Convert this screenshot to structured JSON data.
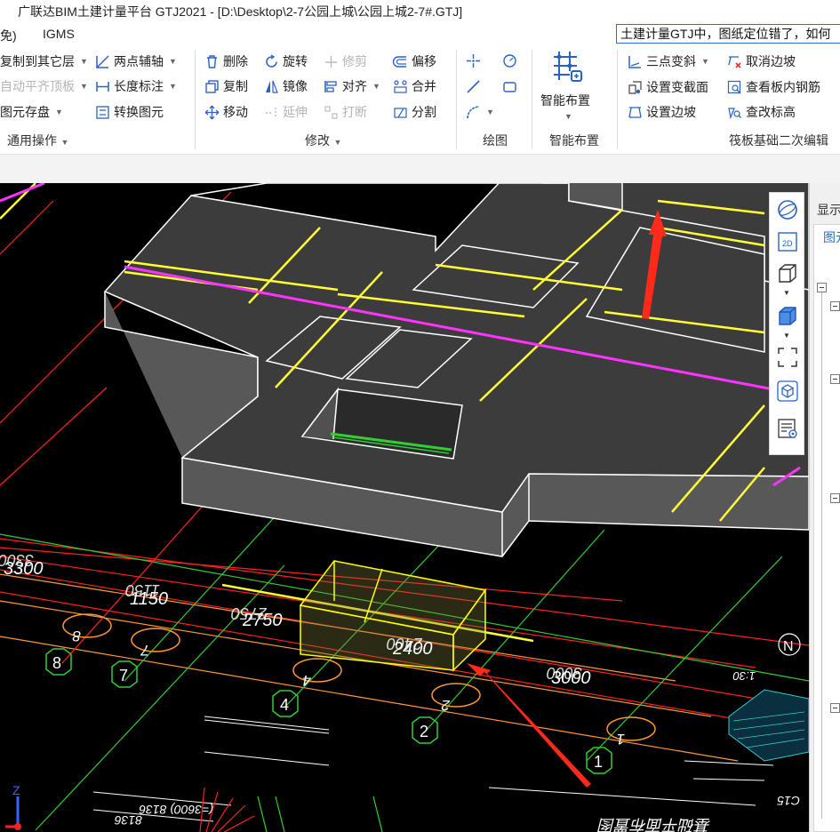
{
  "window": {
    "title": "广联达BIM土建计量平台 GTJ2021 - [D:\\Desktop\\2-7公园上城\\公园上城2-7#.GTJ]"
  },
  "menu": {
    "items": [
      "免)",
      "IGMS"
    ],
    "search_text": "土建计量GTJ中，图纸定位错了，如何"
  },
  "ribbon": {
    "general": {
      "copy_to_layer": "复制到其它层",
      "auto_align_top": "自动平齐顶板",
      "save_element": "图元存盘",
      "two_point_axis": "两点辅轴",
      "length_mark": "长度标注",
      "convert_element": "转换图元",
      "group_label": "通用操作"
    },
    "modify": {
      "delete": "删除",
      "copy": "复制",
      "move": "移动",
      "rotate": "旋转",
      "mirror": "镜像",
      "extend": "延伸",
      "trim": "修剪",
      "align": "对齐",
      "break": "打断",
      "offset": "偏移",
      "merge": "合并",
      "split": "分割",
      "group_label": "修改"
    },
    "draw": {
      "group_label": "绘图"
    },
    "smart": {
      "label": "智能布置",
      "group_label": "智能布置"
    },
    "raft": {
      "three_point_slope": "三点变斜",
      "set_variable_section": "设置变截面",
      "set_slope_edge": "设置边坡",
      "cancel_slope_edge": "取消边坡",
      "view_rebar_in_slab": "查看板内钢筋",
      "change_elevation": "查改标高",
      "group_label": "筏板基础二次编辑"
    }
  },
  "viewport": {
    "dims": [
      "3300",
      "1150",
      "2750",
      "2400",
      "3000"
    ],
    "axes": [
      "8",
      "7",
      "4",
      "2",
      "1"
    ],
    "axes_mirrored": [
      "8",
      "7",
      "4",
      "2",
      "1"
    ],
    "dims_mirrored": [
      "3300",
      "1150",
      "2750",
      "2400",
      "3000"
    ],
    "north": "N",
    "scale_mark": "1:30",
    "drawing_text_1": "(=3600) 8136",
    "drawing_text_2": "8136",
    "axis_z": "Z",
    "bottom_label": "基础平面布置图",
    "note_c15": "C15",
    "colors": {
      "background": "#000000",
      "slab_top": "#3a3a3a",
      "slab_side": "#5a5a5a",
      "edge": "#ffffff",
      "beam": "#ffff33",
      "magenta_axis": "#ff33ff",
      "red_axis": "#ff2020",
      "orange_axis": "#ff9933",
      "green_axis": "#33cc33",
      "arrow": "#ff2a1a",
      "selection": "#ffff00"
    }
  },
  "view_toolbar": {
    "icons": [
      "orbit-icon",
      "2d-view-icon",
      "3d-view-icon",
      "3d-shaded-icon",
      "zoom-extent-icon",
      "isometric-icon",
      "display-settings-icon"
    ]
  },
  "right_panel": {
    "tab": "显示",
    "subtab": "图元"
  }
}
